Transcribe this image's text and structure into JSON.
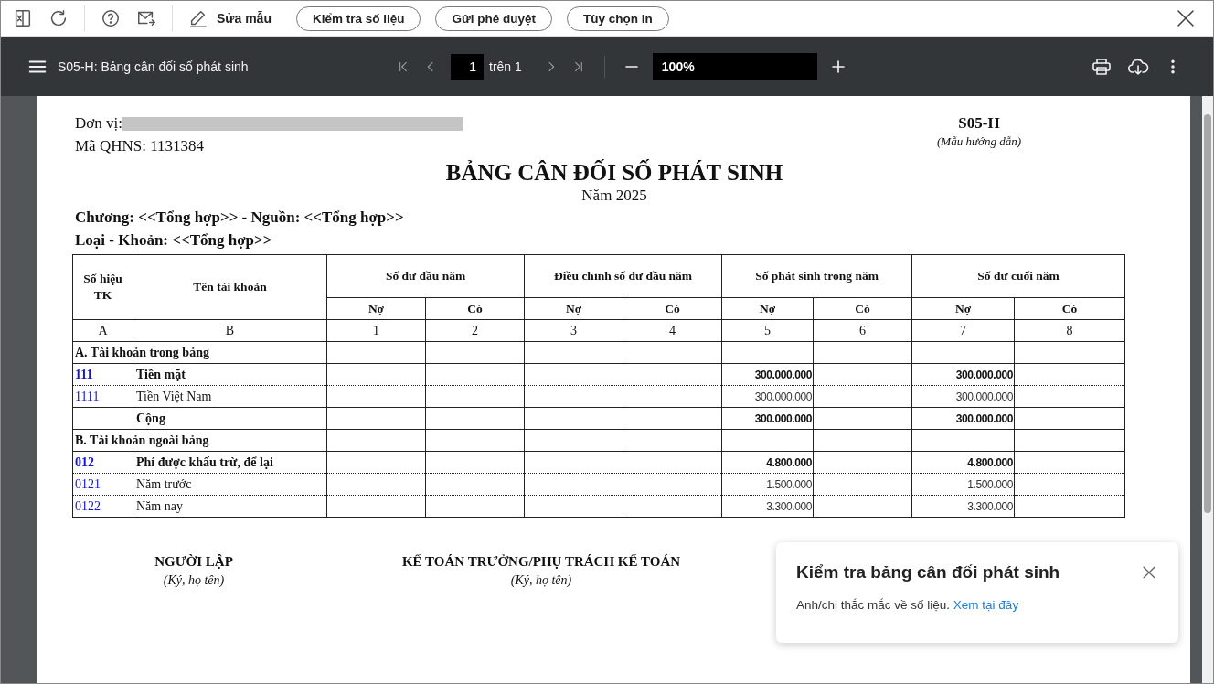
{
  "toolbar": {
    "edit_label": "Sửa mẫu",
    "buttons": [
      "Kiểm tra số liệu",
      "Gửi phê duyệt",
      "Tùy chọn in"
    ]
  },
  "viewer": {
    "title": "S05-H: Bảng cân đối số phát sinh",
    "page": "1",
    "page_total": "trên 1",
    "zoom": "100%"
  },
  "document": {
    "unit_label": "Đơn vị:",
    "code_line": "Mã QHNS:  1131384",
    "form_code": "S05-H",
    "form_note": "(Mẫu hướng dẫn)",
    "title": "BẢNG CÂN ĐỐI SỐ PHÁT SINH",
    "year": "Năm 2025",
    "filters": [
      "Chương: <<Tổng hợp>> - Nguồn: <<Tổng hợp>>",
      "Loại - Khoản: <<Tổng hợp>>"
    ],
    "table": {
      "code_header": "Số hiệu TK",
      "name_header": "Tên tài khoản",
      "groups": [
        {
          "label": "Số dư đầu năm",
          "sub": [
            "Nợ",
            "Có"
          ]
        },
        {
          "label": "Điều chỉnh số dư đầu năm",
          "sub": [
            "Nợ",
            "Có"
          ]
        },
        {
          "label": "Số phát sinh trong năm",
          "sub": [
            "Nợ",
            "Có"
          ]
        },
        {
          "label": "Số dư cuối năm",
          "sub": [
            "Nợ",
            "Có"
          ]
        }
      ],
      "index": [
        "A",
        "B",
        "1",
        "2",
        "3",
        "4",
        "5",
        "6",
        "7",
        "8"
      ],
      "rows": [
        {
          "kind": "section",
          "name": "A. Tài khoản trong bảng"
        },
        {
          "kind": "group",
          "code": "111",
          "name": "Tiền mặt",
          "column_5": "300.000.000",
          "column_7": "300.000.000"
        },
        {
          "kind": "detail",
          "code": "1111",
          "name": "Tiền Việt Nam",
          "column_5": "300.000.000",
          "column_7": "300.000.000"
        },
        {
          "kind": "total",
          "name": "Cộng",
          "column_5": "300.000.000",
          "column_7": "300.000.000"
        },
        {
          "kind": "section",
          "name": "B. Tài khoản ngoài bảng"
        },
        {
          "kind": "group",
          "code": "012",
          "name": "Phí được khấu trừ, để lại",
          "column_5": "4.800.000",
          "column_7": "4.800.000"
        },
        {
          "kind": "detail",
          "code": "0121",
          "name": "Năm trước",
          "column_5": "1.500.000",
          "column_7": "1.500.000"
        },
        {
          "kind": "detail",
          "code": "0122",
          "name": "Năm nay",
          "column_5": "3.300.000",
          "column_7": "3.300.000"
        }
      ]
    },
    "signatures": [
      {
        "role": "NGƯỜI LẬP",
        "note": "(Ký, họ tên)"
      },
      {
        "role": "KẾ TOÁN TRƯỞNG/PHỤ TRÁCH KẾ TOÁN",
        "note": "(Ký, họ tên)"
      }
    ]
  },
  "toast": {
    "title": "Kiểm tra bảng cân đối phát sinh",
    "message": "Anh/chị thắc mắc về số liệu.",
    "link": "Xem tại đây"
  }
}
